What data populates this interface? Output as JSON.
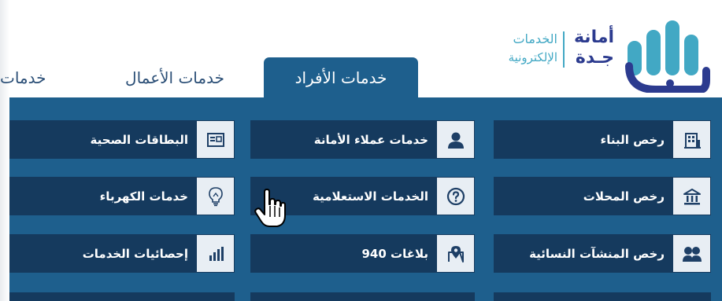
{
  "logo": {
    "amana": "أمانة",
    "jeddah": "جـدة",
    "services": "الخدمات",
    "electronic": "الإلكترونية"
  },
  "tabs": [
    {
      "label": "خدمات الأفراد",
      "active": true
    },
    {
      "label": "خدمات الأعمال",
      "active": false
    },
    {
      "label": "خدمات",
      "active": false
    }
  ],
  "services": {
    "col1": [
      {
        "label": "رخص البناء",
        "icon": "building-icon"
      },
      {
        "label": "رخص المحلات",
        "icon": "bank-icon"
      },
      {
        "label": "رخص المنشآت النسائية",
        "icon": "women-icon"
      }
    ],
    "col2": [
      {
        "label": "خدمات عملاء الأمانة",
        "icon": "user-icon"
      },
      {
        "label": "الخدمات الاستعلامية",
        "icon": "question-icon"
      },
      {
        "label": "بلاغات 940",
        "icon": "map-pin-icon"
      }
    ],
    "col3": [
      {
        "label": "البطاقات الصحية",
        "icon": "card-icon"
      },
      {
        "label": "خدمات الكهرباء",
        "icon": "lightbulb-icon"
      },
      {
        "label": "إحصائيات الخدمات",
        "icon": "bar-chart-icon"
      }
    ]
  },
  "colors": {
    "band": "#1e5f8d",
    "button": "#153a5e",
    "icon_bg": "#e8eef4",
    "icon_fg": "#1e3f66",
    "logo_navy": "#2c3b8f",
    "logo_teal": "#42a8c4"
  }
}
